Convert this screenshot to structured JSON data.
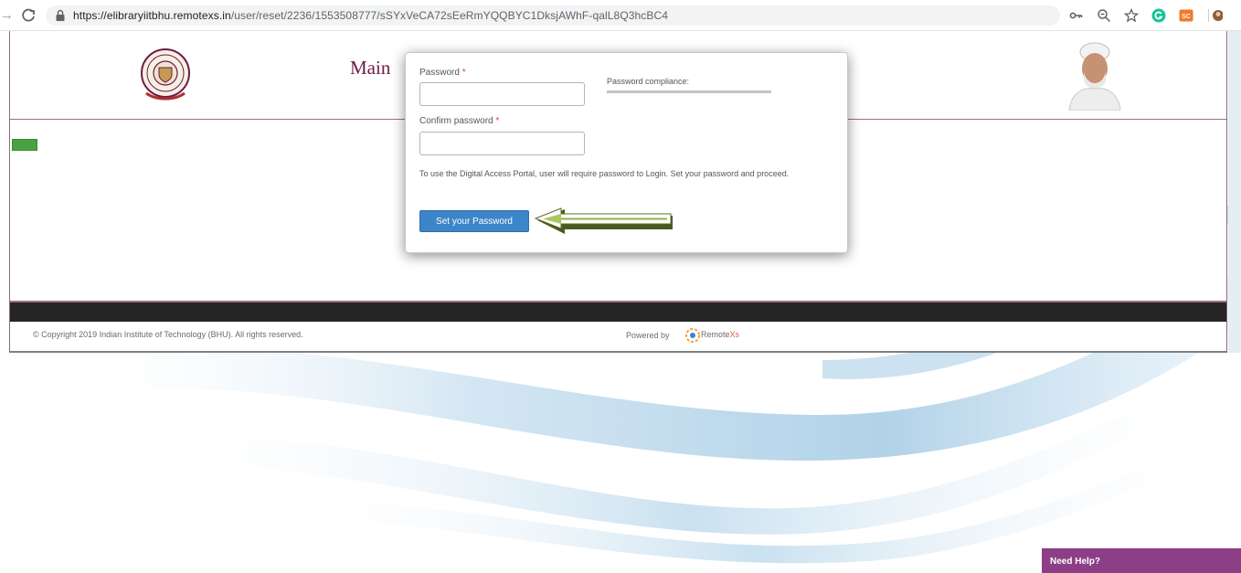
{
  "browser": {
    "url_host": "https://elibraryiitbhu.remotexs.in",
    "url_path": "/user/reset/2236/1553508777/sSYxVeCA72sEeRmYQQBYC1DksjAWhF-qalL8Q3hcBC4",
    "icons": [
      "forward-icon",
      "reload-icon",
      "lock-icon",
      "key-icon",
      "zoom-icon",
      "star-icon",
      "grammarly-icon",
      "sc-extension-icon",
      "profile-icon"
    ],
    "sc_badge": "SC"
  },
  "header": {
    "title": "Main"
  },
  "modal": {
    "password_label": "Password",
    "required_mark": "*",
    "confirm_label": "Confirm password",
    "compliance_label": "Password compliance:",
    "info_text": "To use the Digital Access Portal, user will require password to Login. Set your password and proceed.",
    "submit_label": "Set your Password",
    "password_value": "",
    "confirm_value": ""
  },
  "footer": {
    "copyright": "© Copyright 2019 Indian Institute of Technology (BHU). All rights reserved.",
    "powered_by": "Powered by",
    "remotexs_prefix": "Remote",
    "remotexs_suffix": "Xs"
  },
  "help": {
    "label": "Need Help?"
  },
  "colors": {
    "accent": "#3d85c9",
    "brand": "#6e1b46",
    "help": "#8c3f86",
    "green": "#4aa142"
  }
}
